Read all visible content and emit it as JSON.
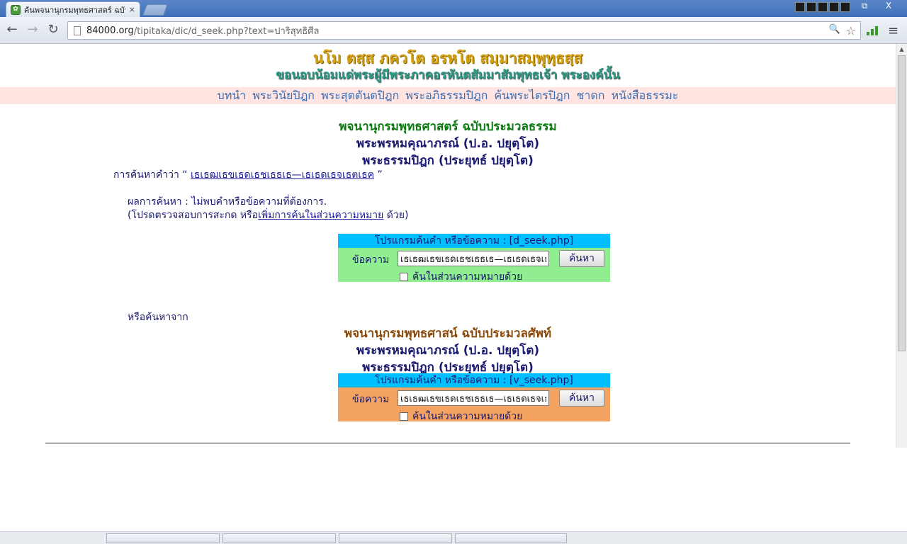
{
  "browser": {
    "tab_title": "ค้นพจนานุกรมพุทธศาสตร์ ฉบับ",
    "tab_close": "×",
    "window_minimize": "─",
    "window_restore": "⧉",
    "window_close": "X",
    "url_host": "84000.org",
    "url_path": "/tipitaka/dic/d_seek.php?text=ปาริสุทธิศีล",
    "back_glyph": "←",
    "forward_glyph": "→",
    "reload_glyph": "↻",
    "zoom_glyph": "🔍",
    "star_glyph": "☆",
    "menu_glyph": "≡"
  },
  "header": {
    "line1": "นโม ตสฺส ภควโต อรหโต สมฺมาสมฺพุทฺธสฺส",
    "line2": "ขอนอบน้อมแด่พระผู้มีพระภาคอรหันตสัมมาสัมพุทธเจ้า  พระองค์นั้น"
  },
  "nav": {
    "items": [
      "บทนำ",
      "พระวินัยปิฎก",
      "พระสุตตันตปิฎก",
      "พระอภิธรรมปิฎก",
      "ค้นพระไตรปิฎก",
      "ชาดก",
      "หนังสือธรรมะ"
    ]
  },
  "dict1": {
    "title": "พจนานุกรมพุทธศาสตร์ ฉบับประมวลธรรม",
    "author1": "พระพรหมคุณาภรณ์ (ป.อ. ปยุตฺโต)",
    "author2": "พระธรรมปิฎก (ประยุทธ์ ปยุตฺโต)"
  },
  "search": {
    "prefix": "การค้นหาคำว่า “",
    "term": "เธเธฒเธขเธดเธชเธธเธ—เธเธดเธจเธตเธฅ",
    "suffix": "”",
    "result_line": "ผลการค้นหา : ไม่พบคำหรือข้อความที่ต้องการ.",
    "hint_prefix": "(โปรดตรวจสอบการสะกด หรือ",
    "hint_link": "เพิ่มการค้นในส่วนความหมาย",
    "hint_suffix": " ด้วย)",
    "or_search": "หรือค้นหาจาก"
  },
  "box1": {
    "heading": "โปรแกรมค้นคำ หรือข้อความ : [d_seek.php]",
    "label": "ข้อความ",
    "input_value": "เธเธฒเธขเธดเธชเธธเธ—เธเธดเธจเธตเธฅ",
    "button": "ค้นหา",
    "checkbox_label": "ค้นในส่วนความหมายด้วย"
  },
  "dict2": {
    "title": "พจนานุกรมพุทธศาสน์ ฉบับประมวลศัพท์",
    "author1": "พระพรหมคุณาภรณ์ (ป.อ. ปยุตฺโต)",
    "author2": "พระธรรมปิฎก (ประยุทธ์ ปยุตฺโต)"
  },
  "box2": {
    "heading": "โปรแกรมค้นคำ หรือข้อความ : [v_seek.php]",
    "label": "ข้อความ",
    "input_value": "เธเธฒเธขเธดเธชเธธเธ—เธเธดเธจเธตเธฅ",
    "button": "ค้นหา",
    "checkbox_label": "ค้นในส่วนความหมายด้วย"
  },
  "colors": {
    "box_heading": "#00bfff",
    "box1_body": "#90ee90",
    "box2_body": "#f4a460",
    "nav_bg": "#ffe4e1"
  }
}
